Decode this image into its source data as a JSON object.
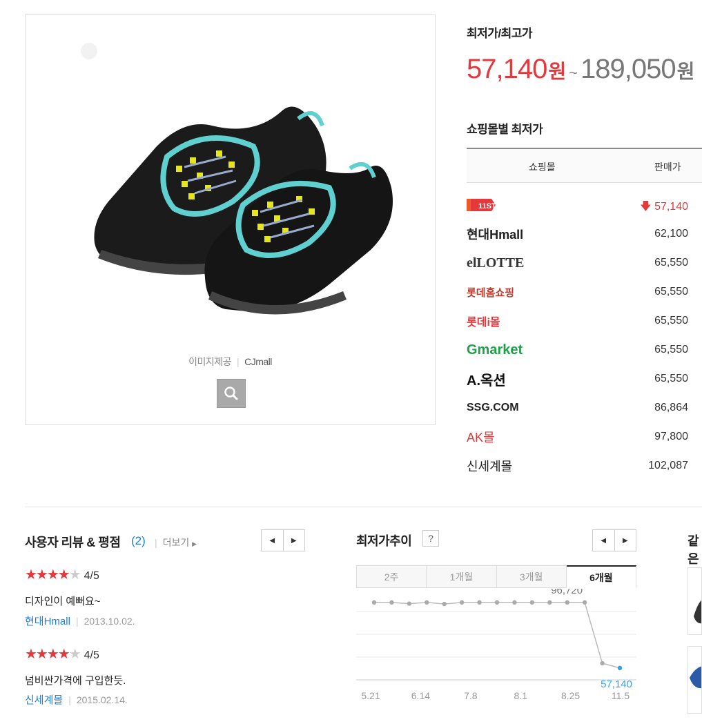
{
  "product": {
    "image_alt": "black hiking shoes with mint trim and yellow laces",
    "credit_label": "이미지제공",
    "credit_source": "CJmall",
    "zoom_icon": "search-icon"
  },
  "price_summary": {
    "label": "최저가/최고가",
    "low": "57,140",
    "high": "189,050",
    "won": "원",
    "tilde": "~"
  },
  "mall_table": {
    "label": "쇼핑몰별 최저가",
    "col_mall": "쇼핑몰",
    "col_price": "판매가",
    "rows": [
      {
        "mall": "11번가",
        "logo_text": "11ST",
        "price": "57,140",
        "lowest": true
      },
      {
        "mall": "현대Hmall",
        "logo_text": "현대Hmall",
        "price": "62,100"
      },
      {
        "mall": "엘롯데",
        "logo_text": "elLOTTE",
        "price": "65,550"
      },
      {
        "mall": "롯데홈쇼핑",
        "logo_text": "롯데홈쇼핑",
        "price": "65,550"
      },
      {
        "mall": "롯데i몰",
        "logo_text": "롯데i몰",
        "price": "65,550"
      },
      {
        "mall": "G마켓",
        "logo_text": "Gmarket",
        "price": "65,550"
      },
      {
        "mall": "옥션",
        "logo_text": "A.옥션",
        "price": "65,550"
      },
      {
        "mall": "SSG.COM",
        "logo_text": "SSG.COM",
        "price": "86,864"
      },
      {
        "mall": "AK몰",
        "logo_text": "AK몰",
        "price": "97,800"
      },
      {
        "mall": "신세계몰",
        "logo_text": "신세계몰",
        "price": "102,087"
      }
    ],
    "down_arrow_icon": "arrow-down-icon"
  },
  "reviews": {
    "title": "사용자 리뷰 & 평점",
    "count": "(2)",
    "more": "더보기",
    "items": [
      {
        "rating": 4,
        "score": "4/5",
        "text": "디자인이 예뻐요~",
        "source": "현대Hmall",
        "date": "2013.10.02."
      },
      {
        "rating": 4,
        "score": "4/5",
        "text": "넘비싼가격에 구입한듯.",
        "source": "신세계몰",
        "date": "2015.02.14."
      }
    ]
  },
  "trend": {
    "title": "최저가추이",
    "help": "?",
    "tabs": [
      {
        "label": "2주",
        "active": false
      },
      {
        "label": "1개월",
        "active": false
      },
      {
        "label": "3개월",
        "active": false
      },
      {
        "label": "6개월",
        "active": true
      }
    ]
  },
  "next_section": {
    "title": "같은"
  },
  "chart_data": {
    "type": "line",
    "x_tick_labels": [
      "5.21",
      "6.14",
      "7.8",
      "8.1",
      "8.25",
      "11.5"
    ],
    "values": [
      96720,
      96720,
      96000,
      96720,
      95800,
      96720,
      96720,
      96720,
      96720,
      96720,
      96720,
      96720,
      96720,
      60000,
      57140
    ],
    "annotations": [
      {
        "label": "96,720",
        "value": 96720
      },
      {
        "label": "57,140",
        "value": 57140,
        "highlight": true
      }
    ],
    "ylim": [
      50000,
      105000
    ],
    "grid": true,
    "colors": {
      "line": "#bbbbbb",
      "point": "#aaaaaa",
      "last_point": "#3aa0e6",
      "last_label": "#3aa0e6"
    }
  }
}
